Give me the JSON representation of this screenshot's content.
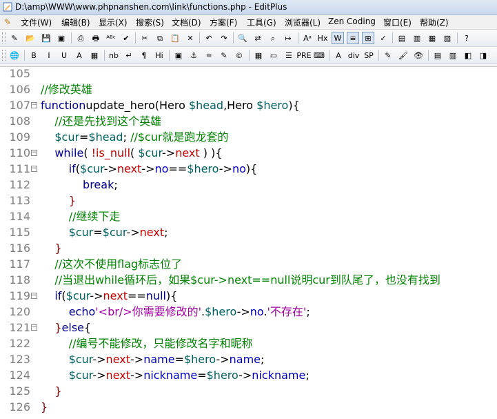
{
  "window": {
    "title": "D:\\amp\\WWW\\www.phpnanshen.com\\link\\functions.php - EditPlus"
  },
  "menubar": {
    "items": [
      "文件(W)",
      "编辑(B)",
      "显示(X)",
      "搜索(S)",
      "文档(D)",
      "方案(F)",
      "工具(G)",
      "浏览器(L)",
      "Zen Coding",
      "窗口(E)",
      "帮助(Z)"
    ]
  },
  "toolbar1": {
    "buttons": [
      {
        "name": "new-file",
        "glyph": "✎"
      },
      {
        "name": "open-file",
        "glyph": "📂"
      },
      {
        "name": "save",
        "glyph": "💾"
      },
      {
        "name": "save-all",
        "glyph": "▣"
      },
      {
        "name": "print-preview",
        "glyph": "⎙"
      },
      {
        "name": "print",
        "glyph": "🖶"
      },
      {
        "name": "spell-check",
        "glyph": "ᴬᴮᶜ"
      },
      {
        "name": "check",
        "glyph": "✔"
      },
      {
        "name": "cut",
        "glyph": "✂"
      },
      {
        "name": "copy",
        "glyph": "⧉"
      },
      {
        "name": "paste",
        "glyph": "📋"
      },
      {
        "name": "delete",
        "glyph": "✕"
      },
      {
        "name": "undo",
        "glyph": "↶"
      },
      {
        "name": "redo",
        "glyph": "↷"
      },
      {
        "name": "find",
        "glyph": "🔍"
      },
      {
        "name": "replace",
        "glyph": "⇄"
      },
      {
        "name": "find-in-files",
        "glyph": "⌕"
      },
      {
        "name": "goto",
        "glyph": "↦"
      },
      {
        "name": "font",
        "glyph": "Aᵃ"
      },
      {
        "name": "hex",
        "glyph": "Hx"
      },
      {
        "name": "word-wrap",
        "glyph": "W"
      },
      {
        "name": "column",
        "glyph": "≡"
      },
      {
        "name": "ruler",
        "glyph": "⊞"
      },
      {
        "name": "spell",
        "glyph": "✓"
      },
      {
        "name": "window-1",
        "glyph": "▤"
      },
      {
        "name": "window-2",
        "glyph": "▥"
      },
      {
        "name": "window-3",
        "glyph": "▦"
      },
      {
        "name": "window-4",
        "glyph": "▧"
      },
      {
        "name": "help",
        "glyph": "?"
      }
    ]
  },
  "toolbar2": {
    "buttons": [
      {
        "name": "browser",
        "glyph": "🌐"
      },
      {
        "name": "bold",
        "glyph": "B"
      },
      {
        "name": "italic",
        "glyph": "I"
      },
      {
        "name": "underline",
        "glyph": "U"
      },
      {
        "name": "font-color",
        "glyph": "A"
      },
      {
        "name": "table-color",
        "glyph": "▦"
      },
      {
        "name": "nbsp",
        "glyph": "nb"
      },
      {
        "name": "br",
        "glyph": "↵"
      },
      {
        "name": "paragraph",
        "glyph": "¶"
      },
      {
        "name": "heading",
        "glyph": "Hi"
      },
      {
        "name": "image",
        "glyph": "▣"
      },
      {
        "name": "anchor",
        "glyph": "⚓"
      },
      {
        "name": "hr",
        "glyph": "═"
      },
      {
        "name": "comment",
        "glyph": "✎"
      },
      {
        "name": "copyright",
        "glyph": "©"
      },
      {
        "name": "table",
        "glyph": "▦"
      },
      {
        "name": "form",
        "glyph": "▭"
      },
      {
        "name": "list",
        "glyph": "☰"
      },
      {
        "name": "pre",
        "glyph": "PRE"
      },
      {
        "name": "script",
        "glyph": "⌨"
      },
      {
        "name": "font-tag",
        "glyph": "A"
      },
      {
        "name": "div",
        "glyph": "div"
      },
      {
        "name": "span",
        "glyph": "SP"
      },
      {
        "name": "edit-tag",
        "glyph": "✎"
      },
      {
        "name": "color-picker",
        "glyph": "🖌"
      },
      {
        "name": "preview",
        "glyph": "👁"
      },
      {
        "name": "toggle-1",
        "glyph": "▤"
      },
      {
        "name": "toggle-2",
        "glyph": "▥"
      },
      {
        "name": "toggle-3",
        "glyph": "◧"
      },
      {
        "name": "toggle-4",
        "glyph": "◨"
      }
    ]
  },
  "editor": {
    "lines": [
      {
        "no": "105",
        "fold": false,
        "tokens": []
      },
      {
        "no": "106",
        "fold": false,
        "tokens": [
          [
            "c",
            "//修改英雄"
          ]
        ]
      },
      {
        "no": "107",
        "fold": true,
        "tokens": [
          [
            "k",
            "function"
          ],
          [
            "",
            "update_hero(Hero "
          ],
          [
            "v",
            "$head"
          ],
          [
            "",
            ",Hero "
          ],
          [
            "v",
            "$hero"
          ],
          [
            "",
            "){"
          ]
        ]
      },
      {
        "no": "108",
        "fold": false,
        "tokens": [
          [
            "",
            "    "
          ],
          [
            "c",
            "//还是先找到这个英雄"
          ]
        ]
      },
      {
        "no": "109",
        "fold": false,
        "tokens": [
          [
            "",
            "    "
          ],
          [
            "v",
            "$cur"
          ],
          [
            "",
            "="
          ],
          [
            "v",
            "$head"
          ],
          [
            "",
            "; "
          ],
          [
            "c",
            "//$cur就是跑龙套的"
          ]
        ]
      },
      {
        "no": "110",
        "fold": true,
        "tokens": [
          [
            "",
            "    "
          ],
          [
            "k",
            "while"
          ],
          [
            "",
            "( "
          ],
          [
            "m",
            "!is_null"
          ],
          [
            "",
            "( "
          ],
          [
            "v",
            "$cur"
          ],
          [
            "",
            "->"
          ],
          [
            "m",
            "next"
          ],
          [
            "",
            " ) ){"
          ]
        ]
      },
      {
        "no": "111",
        "fold": true,
        "tokens": [
          [
            "",
            "        "
          ],
          [
            "k",
            "if"
          ],
          [
            "",
            "("
          ],
          [
            "v",
            "$cur"
          ],
          [
            "",
            "->"
          ],
          [
            "m",
            "next"
          ],
          [
            "",
            "->"
          ],
          [
            "n",
            "no"
          ],
          [
            "",
            "=="
          ],
          [
            "v",
            "$hero"
          ],
          [
            "",
            "->"
          ],
          [
            "n",
            "no"
          ],
          [
            "",
            "){"
          ]
        ]
      },
      {
        "no": "112",
        "fold": false,
        "tokens": [
          [
            "",
            "            "
          ],
          [
            "k",
            "break"
          ],
          [
            "",
            ";"
          ]
        ]
      },
      {
        "no": "113",
        "fold": false,
        "tokens": [
          [
            "",
            "        "
          ],
          [
            "p",
            "}"
          ]
        ]
      },
      {
        "no": "114",
        "fold": false,
        "tokens": [
          [
            "",
            "        "
          ],
          [
            "c",
            "//继续下走"
          ]
        ]
      },
      {
        "no": "115",
        "fold": false,
        "tokens": [
          [
            "",
            "        "
          ],
          [
            "v",
            "$cur"
          ],
          [
            "",
            "="
          ],
          [
            "v",
            "$cur"
          ],
          [
            "",
            "->"
          ],
          [
            "m",
            "next"
          ],
          [
            "",
            ";"
          ]
        ]
      },
      {
        "no": "116",
        "fold": false,
        "tokens": [
          [
            "",
            "    "
          ],
          [
            "p",
            "}"
          ]
        ]
      },
      {
        "no": "117",
        "fold": false,
        "tokens": [
          [
            "",
            "    "
          ],
          [
            "c",
            "//这次不使用flag标志位了"
          ]
        ]
      },
      {
        "no": "118",
        "fold": false,
        "tokens": [
          [
            "",
            "    "
          ],
          [
            "c",
            "//当退出while循环后，如果$cur->next==null说明cur到队尾了，也没有找到"
          ]
        ]
      },
      {
        "no": "119",
        "fold": true,
        "tokens": [
          [
            "",
            "    "
          ],
          [
            "k",
            "if"
          ],
          [
            "",
            "("
          ],
          [
            "v",
            "$cur"
          ],
          [
            "",
            "->"
          ],
          [
            "m",
            "next"
          ],
          [
            "",
            "=="
          ],
          [
            "k",
            "null"
          ],
          [
            "",
            "){"
          ]
        ]
      },
      {
        "no": "120",
        "fold": false,
        "tokens": [
          [
            "",
            "        "
          ],
          [
            "k",
            "echo"
          ],
          [
            "s",
            "'<br/>你需要修改的'"
          ],
          [
            "",
            "."
          ],
          [
            "v",
            "$hero"
          ],
          [
            "",
            "->"
          ],
          [
            "n",
            "no"
          ],
          [
            "",
            "."
          ],
          [
            "s",
            "'不存在'"
          ],
          [
            "",
            ";"
          ]
        ]
      },
      {
        "no": "121",
        "fold": true,
        "tokens": [
          [
            "",
            "    "
          ],
          [
            "p",
            "}"
          ],
          [
            "k",
            "else"
          ],
          [
            "",
            "{"
          ]
        ]
      },
      {
        "no": "122",
        "fold": false,
        "tokens": [
          [
            "",
            "        "
          ],
          [
            "c",
            "//编号不能修改，只能修改名字和昵称"
          ]
        ]
      },
      {
        "no": "123",
        "fold": false,
        "tokens": [
          [
            "",
            "        "
          ],
          [
            "v",
            "$cur"
          ],
          [
            "",
            "->"
          ],
          [
            "m",
            "next"
          ],
          [
            "",
            "->"
          ],
          [
            "n",
            "name"
          ],
          [
            "",
            "="
          ],
          [
            "v",
            "$hero"
          ],
          [
            "",
            "->"
          ],
          [
            "n",
            "name"
          ],
          [
            "",
            ";"
          ]
        ]
      },
      {
        "no": "124",
        "fold": false,
        "tokens": [
          [
            "",
            "        "
          ],
          [
            "v",
            "$cur"
          ],
          [
            "",
            "->"
          ],
          [
            "m",
            "next"
          ],
          [
            "",
            "->"
          ],
          [
            "n",
            "nickname"
          ],
          [
            "",
            "="
          ],
          [
            "v",
            "$hero"
          ],
          [
            "",
            "->"
          ],
          [
            "n",
            "nickname"
          ],
          [
            "",
            ";"
          ]
        ]
      },
      {
        "no": "125",
        "fold": false,
        "tokens": [
          [
            "",
            "    "
          ],
          [
            "p",
            "}"
          ]
        ]
      },
      {
        "no": "126",
        "fold": false,
        "tokens": [
          [
            "p",
            "}"
          ]
        ]
      }
    ]
  }
}
